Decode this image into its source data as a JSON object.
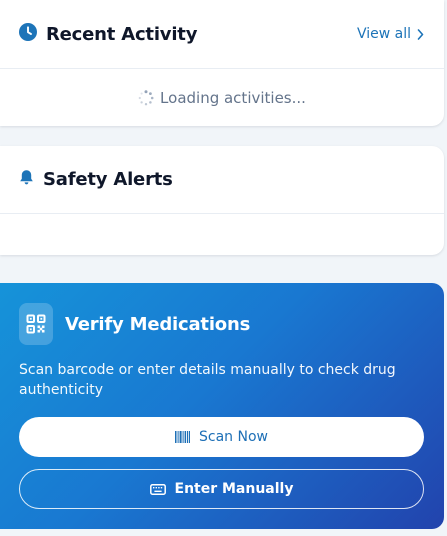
{
  "recent_activity": {
    "title": "Recent Activity",
    "view_all_label": "View all",
    "loading_text": "Loading activities..."
  },
  "safety_alerts": {
    "title": "Safety Alerts"
  },
  "verify": {
    "title": "Verify Medications",
    "description": "Scan barcode or enter details manually to check drug authenticity",
    "scan_button_label": "Scan Now",
    "manual_button_label": "Enter Manually"
  },
  "icons": {
    "activity": "clock-icon",
    "view_all": "chevron-right-icon",
    "loading": "spinner-icon",
    "alerts": "bell-icon",
    "verify": "qr-code-icon",
    "scan": "barcode-icon",
    "manual": "keyboard-icon"
  },
  "colors": {
    "accent": "#1d74b8",
    "title_text": "#0f172a",
    "muted_text": "#64748b",
    "gradient_start": "#1693d9",
    "gradient_end": "#2243ad"
  }
}
